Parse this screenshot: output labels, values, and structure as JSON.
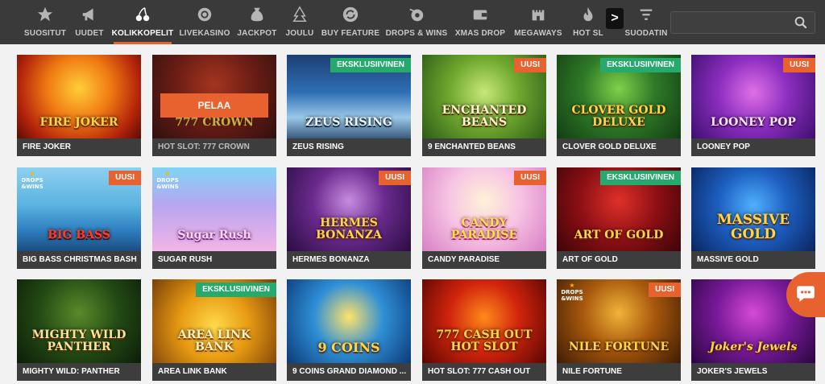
{
  "nav": {
    "items": [
      {
        "label": "SUOSITUT",
        "icon": "star-icon"
      },
      {
        "label": "UUDET",
        "icon": "megaphone-icon"
      },
      {
        "label": "KOLIKKOPELIT",
        "icon": "cherries-icon"
      },
      {
        "label": "LIVEKASINO",
        "icon": "chip-icon"
      },
      {
        "label": "JACKPOT",
        "icon": "moneybag-icon"
      },
      {
        "label": "JOULU",
        "icon": "tree-icon"
      },
      {
        "label": "BUY FEATURE",
        "icon": "refresh-icon"
      },
      {
        "label": "DROPS & WINS",
        "icon": "drops-icon"
      },
      {
        "label": "XMAS DROP",
        "icon": "wallet-icon"
      },
      {
        "label": "MEGAWAYS",
        "icon": "castle-icon"
      },
      {
        "label": "HOT SL",
        "icon": "flame-icon"
      }
    ],
    "scroll_label": ">",
    "filter_label": "SUODATIN",
    "search_placeholder": "",
    "accent": "#e8622f"
  },
  "play_label": "PELAA",
  "games": [
    {
      "name": "FIRE JOKER",
      "art": "FIRE JOKER",
      "badge": ""
    },
    {
      "name": "HOT SLOT: 777 CROWN",
      "art": "777 CROWN",
      "badge": ""
    },
    {
      "name": "ZEUS RISING",
      "art": "ZEUS RISING",
      "badge": "EKSKLUSIIVINEN"
    },
    {
      "name": "9 ENCHANTED BEANS",
      "art": "ENCHANTED BEANS",
      "badge": "UUSI"
    },
    {
      "name": "CLOVER GOLD DELUXE",
      "art": "CLOVER GOLD DELUXE",
      "badge": "EKSKLUSIIVINEN"
    },
    {
      "name": "LOONEY POP",
      "art": "LOONEY POP",
      "badge": "UUSI"
    },
    {
      "name": "BIG BASS CHRISTMAS BASH",
      "art": "BIG BASS",
      "badge": "UUSI",
      "drops": "DROPS &WINS"
    },
    {
      "name": "SUGAR RUSH",
      "art": "Sugar Rush",
      "badge": "",
      "drops": "DROPS &WINS"
    },
    {
      "name": "HERMES BONANZA",
      "art": "HERMES BONANZA",
      "badge": "UUSI"
    },
    {
      "name": "CANDY PARADISE",
      "art": "CANDY PARADISE",
      "badge": "UUSI"
    },
    {
      "name": "ART OF GOLD",
      "art": "ART OF GOLD",
      "badge": "EKSKLUSIIVINEN"
    },
    {
      "name": "MASSIVE GOLD",
      "art": "MASSIVE GOLD",
      "badge": ""
    },
    {
      "name": "MIGHTY WILD: PANTHER",
      "art": "MIGHTY WILD PANTHER",
      "badge": ""
    },
    {
      "name": "AREA LINK BANK",
      "art": "AREA LINK BANK",
      "badge": "EKSKLUSIIVINEN"
    },
    {
      "name": "9 COINS GRAND DIAMOND ...",
      "art": "9 COINS",
      "badge": ""
    },
    {
      "name": "HOT SLOT: 777 CASH OUT",
      "art": "777 CASH OUT HOT SLOT",
      "badge": ""
    },
    {
      "name": "NILE FORTUNE",
      "art": "NILE FORTUNE",
      "badge": "UUSI",
      "drops": "DROPS &WINS"
    },
    {
      "name": "JOKER'S JEWELS",
      "art": "Joker's Jewels",
      "badge": ""
    }
  ]
}
